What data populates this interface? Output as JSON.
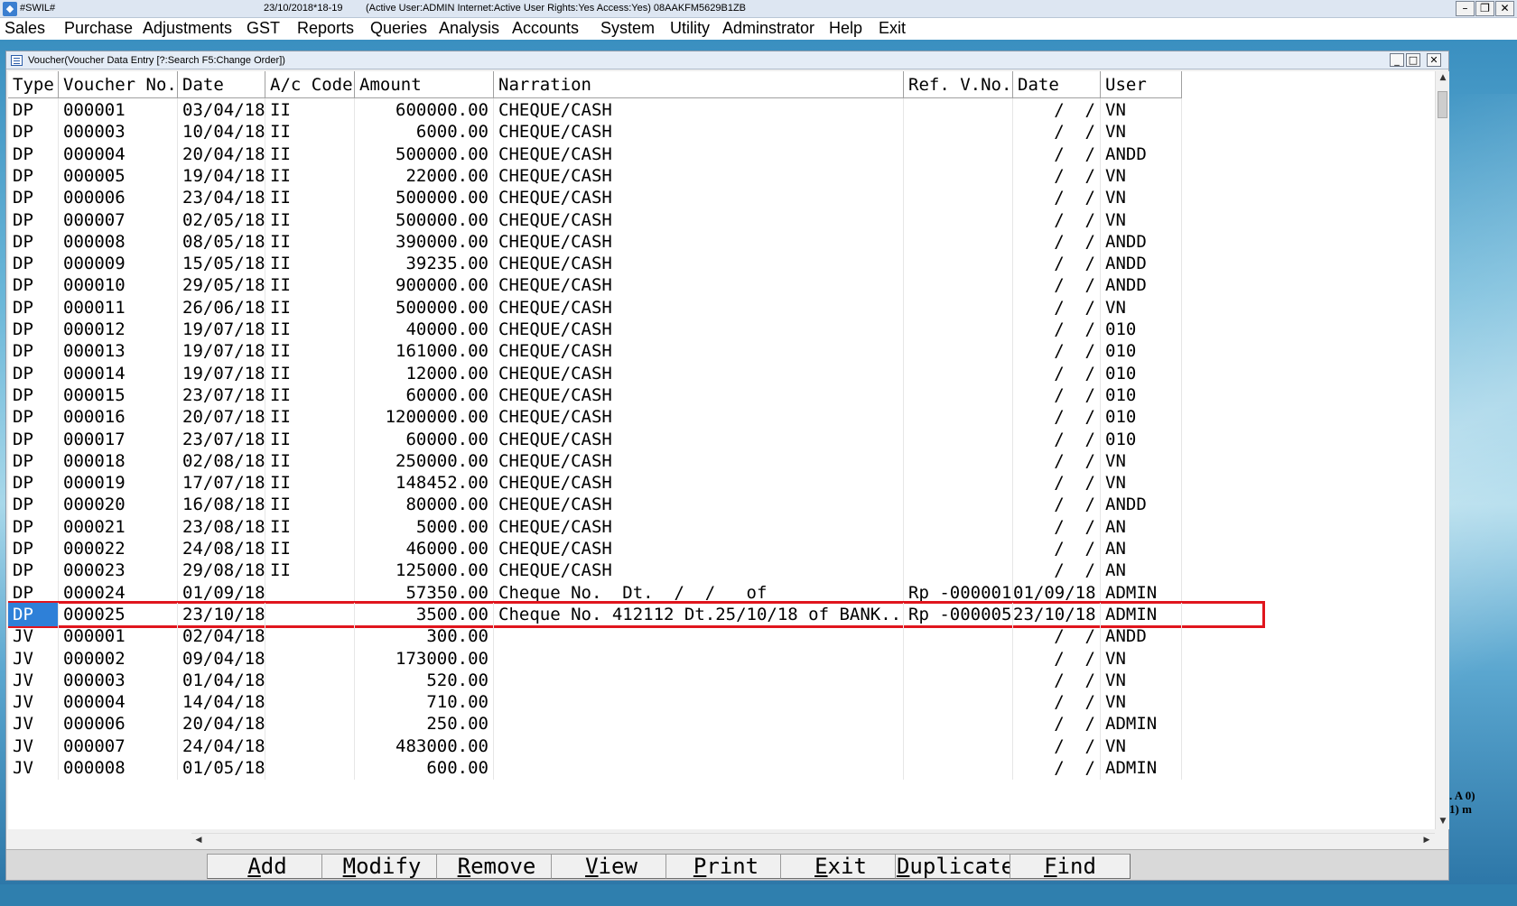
{
  "titlebar": {
    "app_name": "#SWIL#",
    "date_info": "23/10/2018*18-19",
    "status": "(Active User:ADMIN Internet:Active  User Rights:Yes Access:Yes) 08AAKFM5629B1ZB",
    "minimize": "–",
    "restore": "❐",
    "close": "✕"
  },
  "menu": [
    {
      "label": "Sales"
    },
    {
      "label": "Purchase"
    },
    {
      "label": "Adjustments"
    },
    {
      "label": "GST"
    },
    {
      "label": "Reports"
    },
    {
      "label": "Queries"
    },
    {
      "label": "Analysis"
    },
    {
      "label": "Accounts"
    },
    {
      "label": "System"
    },
    {
      "label": "Utility"
    },
    {
      "label": "Adminstrator"
    },
    {
      "label": "Help"
    },
    {
      "label": "Exit"
    }
  ],
  "window": {
    "title": "Voucher(Voucher Data Entry [?:Search F5:Change Order])",
    "minimize": "_",
    "restore": "□",
    "close": "✕"
  },
  "grid": {
    "columns": [
      "Type",
      "Voucher No.",
      "Date",
      "A/c Code",
      "Amount",
      "Narration",
      "Ref. V.No.",
      "Date",
      "User"
    ],
    "selected_index": 23,
    "rows": [
      [
        "DP",
        "000001",
        "03/04/18",
        "II",
        "600000.00",
        "CHEQUE/CASH",
        "",
        "  /  /",
        "VN"
      ],
      [
        "DP",
        "000003",
        "10/04/18",
        "II",
        "6000.00",
        "CHEQUE/CASH",
        "",
        "  /  /",
        "VN"
      ],
      [
        "DP",
        "000004",
        "20/04/18",
        "II",
        "500000.00",
        "CHEQUE/CASH",
        "",
        "  /  /",
        "ANDD"
      ],
      [
        "DP",
        "000005",
        "19/04/18",
        "II",
        "22000.00",
        "CHEQUE/CASH",
        "",
        "  /  /",
        "VN"
      ],
      [
        "DP",
        "000006",
        "23/04/18",
        "II",
        "500000.00",
        "CHEQUE/CASH",
        "",
        "  /  /",
        "VN"
      ],
      [
        "DP",
        "000007",
        "02/05/18",
        "II",
        "500000.00",
        "CHEQUE/CASH",
        "",
        "  /  /",
        "VN"
      ],
      [
        "DP",
        "000008",
        "08/05/18",
        "II",
        "390000.00",
        "CHEQUE/CASH",
        "",
        "  /  /",
        "ANDD"
      ],
      [
        "DP",
        "000009",
        "15/05/18",
        "II",
        "39235.00",
        "CHEQUE/CASH",
        "",
        "  /  /",
        "ANDD"
      ],
      [
        "DP",
        "000010",
        "29/05/18",
        "II",
        "900000.00",
        "CHEQUE/CASH",
        "",
        "  /  /",
        "ANDD"
      ],
      [
        "DP",
        "000011",
        "26/06/18",
        "II",
        "500000.00",
        "CHEQUE/CASH",
        "",
        "  /  /",
        "VN"
      ],
      [
        "DP",
        "000012",
        "19/07/18",
        "II",
        "40000.00",
        "CHEQUE/CASH",
        "",
        "  /  /",
        "010"
      ],
      [
        "DP",
        "000013",
        "19/07/18",
        "II",
        "161000.00",
        "CHEQUE/CASH",
        "",
        "  /  /",
        "010"
      ],
      [
        "DP",
        "000014",
        "19/07/18",
        "II",
        "12000.00",
        "CHEQUE/CASH",
        "",
        "  /  /",
        "010"
      ],
      [
        "DP",
        "000015",
        "23/07/18",
        "II",
        "60000.00",
        "CHEQUE/CASH",
        "",
        "  /  /",
        "010"
      ],
      [
        "DP",
        "000016",
        "20/07/18",
        "II",
        "1200000.00",
        "CHEQUE/CASH",
        "",
        "  /  /",
        "010"
      ],
      [
        "DP",
        "000017",
        "23/07/18",
        "II",
        "60000.00",
        "CHEQUE/CASH",
        "",
        "  /  /",
        "010"
      ],
      [
        "DP",
        "000018",
        "02/08/18",
        "II",
        "250000.00",
        "CHEQUE/CASH",
        "",
        "  /  /",
        "VN"
      ],
      [
        "DP",
        "000019",
        "17/07/18",
        "II",
        "148452.00",
        "CHEQUE/CASH",
        "",
        "  /  /",
        "VN"
      ],
      [
        "DP",
        "000020",
        "16/08/18",
        "II",
        "80000.00",
        "CHEQUE/CASH",
        "",
        "  /  /",
        "ANDD"
      ],
      [
        "DP",
        "000021",
        "23/08/18",
        "II",
        "5000.00",
        "CHEQUE/CASH",
        "",
        "  /  /",
        "AN"
      ],
      [
        "DP",
        "000022",
        "24/08/18",
        "II",
        "46000.00",
        "CHEQUE/CASH",
        "",
        "  /  /",
        "AN"
      ],
      [
        "DP",
        "000023",
        "29/08/18",
        "II",
        "125000.00",
        "CHEQUE/CASH",
        "",
        "  /  /",
        "AN"
      ],
      [
        "DP",
        "000024",
        "01/09/18",
        "",
        "57350.00",
        "Cheque No.  Dt.  /  /   of",
        "Rp -000001",
        "01/09/18",
        "ADMIN"
      ],
      [
        "DP",
        "000025",
        "23/10/18",
        "",
        "3500.00",
        "Cheque No. 412112 Dt.25/10/18 of BANK...",
        "Rp -000005",
        "23/10/18",
        "ADMIN"
      ],
      [
        "JV",
        "000001",
        "02/04/18",
        "",
        "300.00",
        "",
        "",
        "  /  /",
        "ANDD"
      ],
      [
        "JV",
        "000002",
        "09/04/18",
        "",
        "173000.00",
        "",
        "",
        "  /  /",
        "VN"
      ],
      [
        "JV",
        "000003",
        "01/04/18",
        "",
        "520.00",
        "",
        "",
        "  /  /",
        "VN"
      ],
      [
        "JV",
        "000004",
        "14/04/18",
        "",
        "710.00",
        "",
        "",
        "  /  /",
        "VN"
      ],
      [
        "JV",
        "000006",
        "20/04/18",
        "",
        "250.00",
        "",
        "",
        "  /  /",
        "ADMIN"
      ],
      [
        "JV",
        "000007",
        "24/04/18",
        "",
        "483000.00",
        "",
        "",
        "  /  /",
        "VN"
      ],
      [
        "JV",
        "000008",
        "01/05/18",
        "",
        "600.00",
        "",
        "",
        "  /  /",
        "ADMIN"
      ]
    ]
  },
  "buttons": [
    {
      "label": "Add",
      "name": "add-button"
    },
    {
      "label": "Modify",
      "name": "modify-button"
    },
    {
      "label": "Remove",
      "name": "remove-button"
    },
    {
      "label": "View",
      "name": "view-button"
    },
    {
      "label": "Print",
      "name": "print-button"
    },
    {
      "label": "Exit",
      "name": "exit-button"
    },
    {
      "label": "Duplicate",
      "name": "duplicate-button"
    },
    {
      "label": "Find",
      "name": "find-button"
    }
  ],
  "desktop_text": ". A 0) 1) m",
  "colors": {
    "selection": "#2e80d8",
    "highlight_border": "#e0151d"
  }
}
